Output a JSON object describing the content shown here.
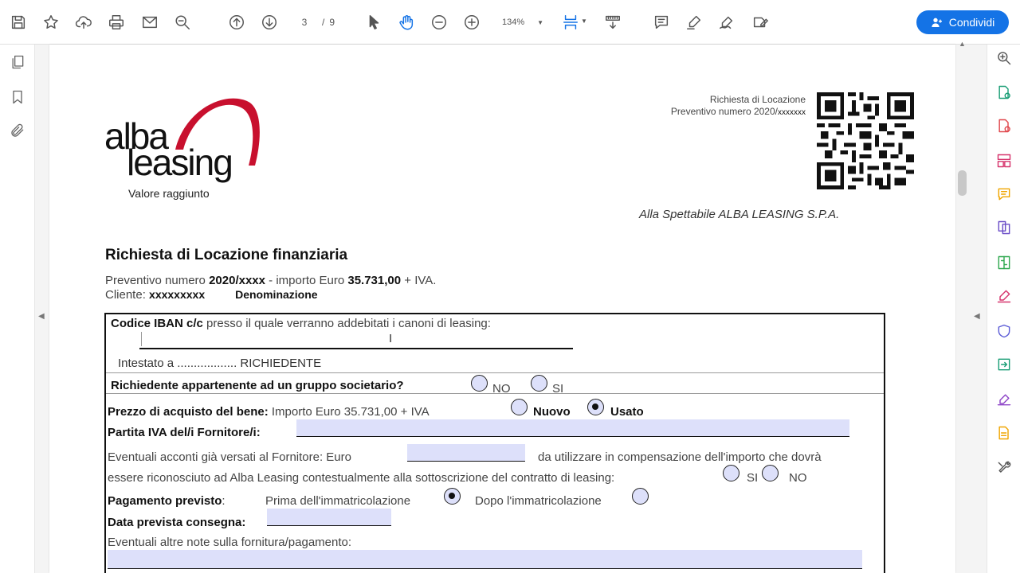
{
  "toolbar": {
    "page_current": "3",
    "page_separator": "/",
    "page_total": "9",
    "zoom": "134%",
    "share_label": "Condividi"
  },
  "colors": {
    "accent": "#1473e6",
    "form_field": "#dde0fa",
    "logo_red": "#c8102e"
  },
  "document": {
    "logo_line1": "alba",
    "logo_line2": "leasing",
    "tagline": "Valore raggiunto",
    "header_right_1": "Richiesta di Locazione",
    "header_right_2_prefix": "Preventivo numero 2020/",
    "header_right_2_suffix": "xxxxxxx",
    "addressee": "Alla Spettabile ALBA LEASING S.P.A.",
    "title": "Richiesta di Locazione finanziaria",
    "quote_prefix": "Preventivo numero ",
    "quote_number": "2020/xxxx",
    "quote_mid": " - importo Euro ",
    "quote_amount": "35.731,00",
    "quote_suffix": " + IVA.",
    "client_label": "Cliente: ",
    "client_value": "xxxxxxxxx",
    "client_denomination": "Denominazione"
  },
  "form": {
    "iban_bold": "Codice IBAN c/c",
    "iban_text": " presso il quale verranno addebitati i canoni di leasing:",
    "intestato": "Intestato a .................. RICHIEDENTE",
    "group_question": "Richiedente appartenente ad un gruppo societario?",
    "opt_no": "NO",
    "opt_si": "SI",
    "price_bold": "Prezzo di acquisto del bene:",
    "price_text": " Importo Euro 35.731,00 + IVA",
    "opt_nuovo": "Nuovo",
    "opt_usato": "Usato",
    "vat_label": "Partita IVA del/i Fornitore/i:",
    "deposit_line1a": "Eventuali acconti già versati al Fornitore: Euro",
    "deposit_line1b": "da utilizzare in compensazione dell'importo che dovrà",
    "deposit_line2": "essere riconosciuto ad Alba Leasing contestualmente alla sottoscrizione del contratto di leasing:",
    "deposit_si": "SI",
    "deposit_no": "NO",
    "payment_bold": "Pagamento previsto",
    "payment_colon": ":",
    "payment_opt1": "Prima dell'immatricolazione",
    "payment_opt2": "Dopo l'immatricolazione",
    "delivery_label": "Data prevista consegna:",
    "notes_label": "Eventuali altre note sulla fornitura/pagamento:"
  }
}
